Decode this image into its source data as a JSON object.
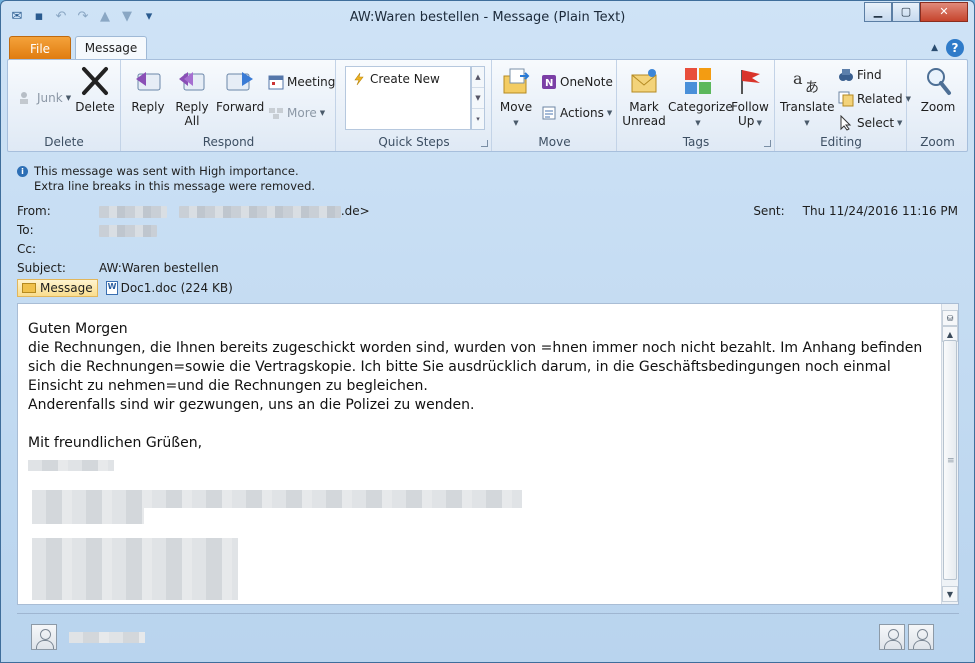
{
  "window": {
    "title": "AW:Waren bestellen  -  Message (Plain Text)",
    "minimize_glyph": "▁",
    "maximize_glyph": "▢",
    "close_glyph": "✕"
  },
  "tabs": {
    "file": "File",
    "message": "Message"
  },
  "ribbon": {
    "delete_group": {
      "label": "Delete",
      "junk": "Junk",
      "delete": "Delete"
    },
    "respond_group": {
      "label": "Respond",
      "reply": "Reply",
      "reply_all_1": "Reply",
      "reply_all_2": "All",
      "forward": "Forward",
      "meeting": "Meeting",
      "more": "More"
    },
    "quick_steps_group": {
      "label": "Quick Steps",
      "create_new": "Create New"
    },
    "move_group": {
      "label": "Move",
      "move": "Move",
      "onenote": "OneNote",
      "actions": "Actions"
    },
    "tags_group": {
      "label": "Tags",
      "mark_unread_1": "Mark",
      "mark_unread_2": "Unread",
      "categorize": "Categorize",
      "follow_up_1": "Follow",
      "follow_up_2": "Up"
    },
    "editing_group": {
      "label": "Editing",
      "translate": "Translate",
      "find": "Find",
      "related": "Related",
      "select": "Select"
    },
    "zoom_group": {
      "label": "Zoom",
      "zoom": "Zoom"
    }
  },
  "info_bar": {
    "line1": "This message was sent with High importance.",
    "line2": "Extra line breaks in this message were removed."
  },
  "header": {
    "from_label": "From:",
    "from_suffix": ".de>",
    "to_label": "To:",
    "cc_label": "Cc:",
    "subject_label": "Subject:",
    "subject": "AW:Waren bestellen",
    "sent_label": "Sent:",
    "sent_value": "Thu 11/24/2016 11:16 PM"
  },
  "attachments": {
    "message_tab": "Message",
    "file": "Doc1.doc (224 KB)"
  },
  "body": {
    "text": "Guten Morgen\ndie Rechnungen, die Ihnen bereits zugeschickt worden sind, wurden von =hnen immer noch nicht bezahlt. Im Anhang befinden sich die Rechnungen=sowie die Vertragskopie. Ich bitte Sie ausdrücklich darum, in die Geschäftsbedingungen noch einmal Einsicht zu nehmen=und die Rechnungen zu begleichen.\nAnderenfalls sind wir gezwungen, uns an die Polizei zu wenden.\n\nMit freundlichen Grüßen,"
  }
}
